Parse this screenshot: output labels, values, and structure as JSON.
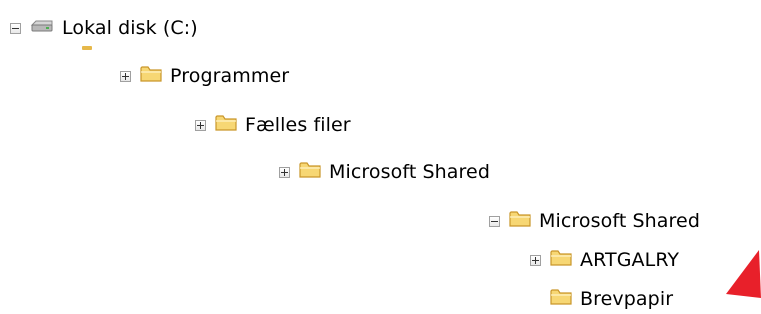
{
  "tree": {
    "nodes": [
      {
        "id": "drive-c",
        "label": "Lokal disk (C:)",
        "icon": "drive-icon",
        "expander": "expanded"
      },
      {
        "id": "programmer",
        "label": "Programmer",
        "icon": "folder-icon",
        "expander": "collapsed"
      },
      {
        "id": "faelles-filer",
        "label": "Fælles filer",
        "icon": "folder-icon",
        "expander": "collapsed"
      },
      {
        "id": "microsoft-shared-1",
        "label": "Microsoft Shared",
        "icon": "folder-icon",
        "expander": "collapsed"
      },
      {
        "id": "microsoft-shared-2",
        "label": "Microsoft Shared",
        "icon": "folder-icon",
        "expander": "expanded"
      },
      {
        "id": "artgalry",
        "label": "ARTGALRY",
        "icon": "folder-icon",
        "expander": "collapsed"
      },
      {
        "id": "brevpapir",
        "label": "Brevpapir",
        "icon": "folder-icon",
        "expander": "none"
      }
    ]
  },
  "colors": {
    "folder_fill": "#f7d774",
    "folder_edge": "#c9962a",
    "arrow": "#e8202a",
    "text": "#000000"
  }
}
